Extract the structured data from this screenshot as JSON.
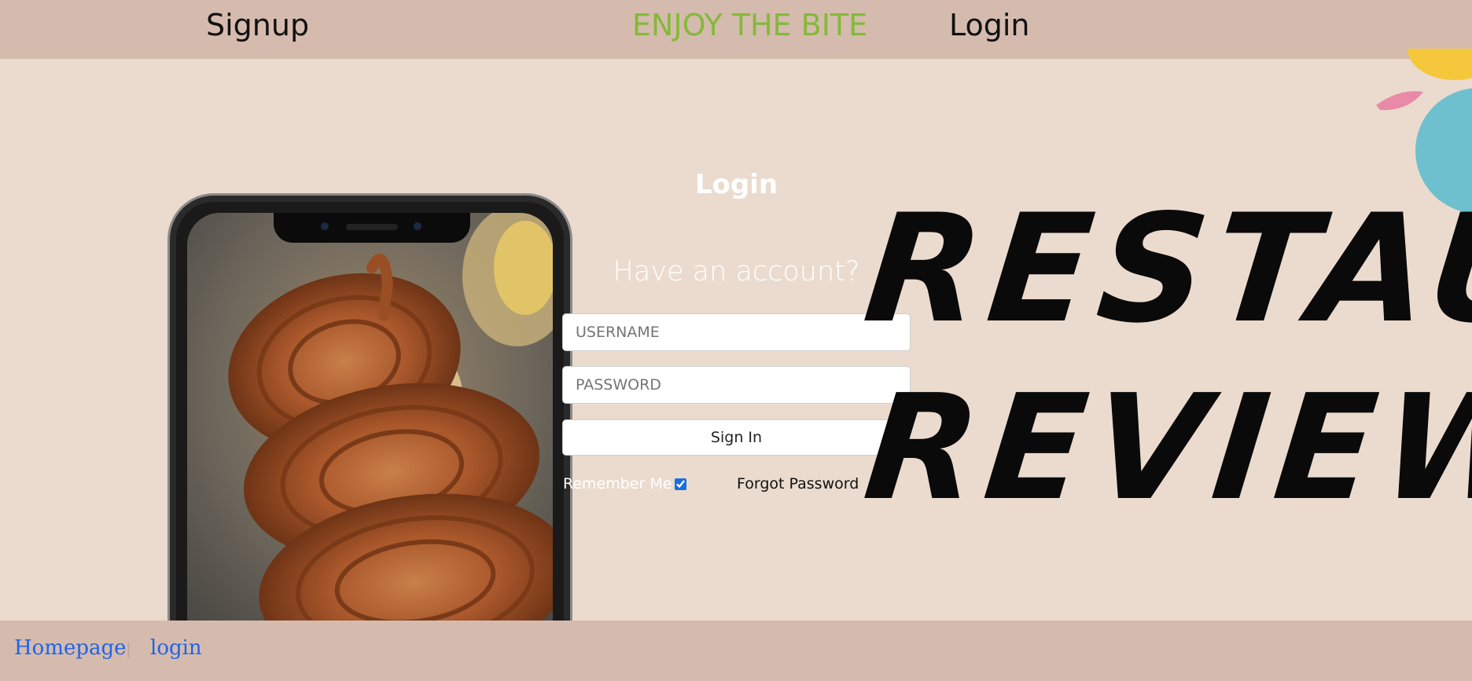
{
  "nav": {
    "signup": "Signup",
    "brand": "ENJOY THE BITE",
    "login": "Login"
  },
  "login_form": {
    "title": "Login",
    "subtitle": "Have an account?",
    "username_placeholder": "USERNAME",
    "password_placeholder": "PASSWORD",
    "signin_label": "Sign In",
    "remember_label": "Remember Me",
    "remember_checked": true,
    "forgot_label": "Forgot Password"
  },
  "art": {
    "line1": "RESTAUR",
    "line2": "REVIEW"
  },
  "footer": {
    "home": "Homepage",
    "separator": "|",
    "login": "login"
  },
  "colors": {
    "nav_bg": "#d5bbae",
    "page_bg": "#ebdbce",
    "brand": "#84b93a",
    "link": "#1f63e8",
    "art_blob_yellow": "#f5c83c",
    "art_blob_pink": "#e88aa8",
    "art_blob_teal": "#6ec0cf"
  },
  "icons": [
    "phone-mockup-image",
    "food-photo-image",
    "checkbox-icon"
  ]
}
